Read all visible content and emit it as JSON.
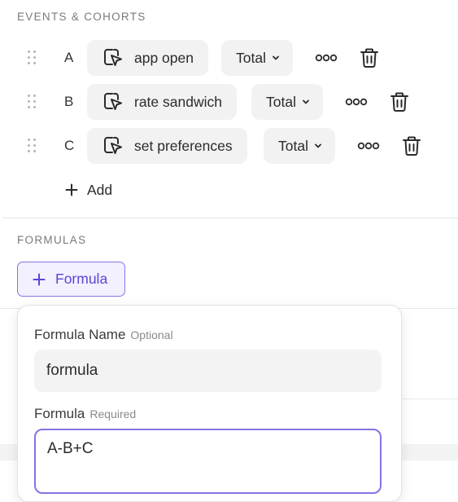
{
  "events_section": {
    "title": "EVENTS & COHORTS",
    "rows": [
      {
        "letter": "A",
        "event": "app open",
        "aggregation": "Total"
      },
      {
        "letter": "B",
        "event": "rate sandwich",
        "aggregation": "Total"
      },
      {
        "letter": "C",
        "event": "set preferences",
        "aggregation": "Total"
      }
    ],
    "add_label": "Add"
  },
  "formulas_section": {
    "title": "FORMULAS",
    "add_formula_label": "Formula"
  },
  "formula_popover": {
    "name_label": "Formula Name",
    "name_hint": "Optional",
    "name_value": "formula",
    "formula_label": "Formula",
    "formula_hint": "Required",
    "formula_value": "A-B+C"
  },
  "colors": {
    "accent": "#8673e6",
    "accent_text": "#5b45d6",
    "accent_bg": "#f3f0ff",
    "chip_bg": "#f2f2f2"
  },
  "icons": {
    "drag": "drag-handle-icon",
    "event": "event-cursor-icon",
    "chevron": "chevron-down-icon",
    "more": "more-options-icon",
    "trash": "trash-icon",
    "plus": "plus-icon"
  }
}
